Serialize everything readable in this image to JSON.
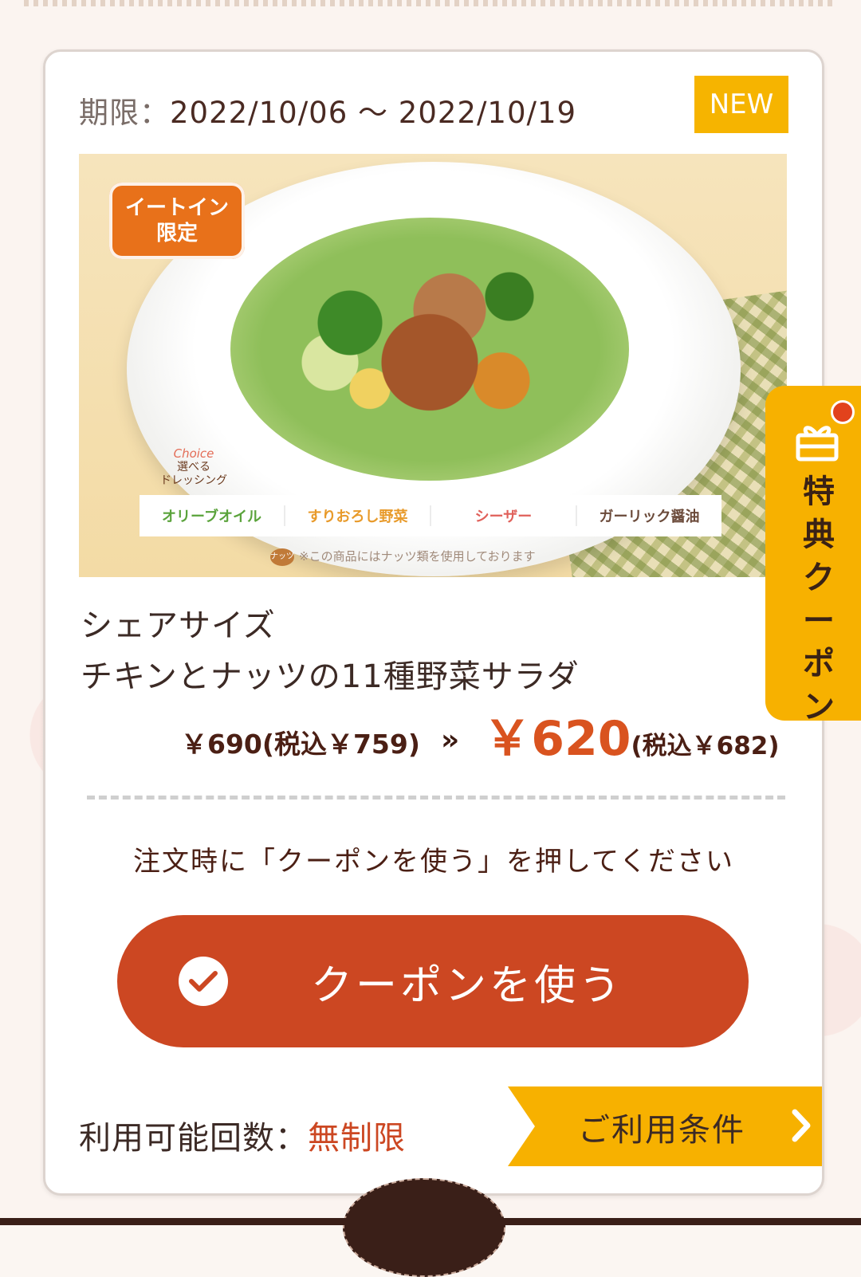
{
  "coupon": {
    "period_label": "期限：",
    "period_value": "2022/10/06 〜 2022/10/19",
    "badge": "NEW",
    "image": {
      "eatin_line1": "イートイン",
      "eatin_line2": "限定",
      "choice_en": "Choice",
      "choice_line1": "選べる",
      "choice_line2": "ドレッシング",
      "dressings": [
        {
          "label": "オリーブオイル",
          "color": "#5aa33b"
        },
        {
          "label": "すりおろし野菜",
          "color": "#e89a2a"
        },
        {
          "label": "シーザー",
          "color": "#e0605a"
        },
        {
          "label": "ガーリック醤油",
          "color": "#6b4a3a"
        }
      ],
      "nuts_icon": "ナッツ",
      "nuts_note": "※この商品にはナッツ類を使用しております"
    },
    "name_line1": "シェアサイズ",
    "name_line2": "チキンとナッツの11種野菜サラダ",
    "price_old": "￥690(税込￥759)",
    "price_new": "￥620",
    "price_new_tax": "(税込￥682)",
    "instruction": "注文時に「クーポンを使う」を押してください",
    "use_button": "クーポンを使う",
    "usage_label": "利用可能回数：",
    "usage_value": "無制限",
    "conditions_label": "ご利用条件"
  },
  "side_tab": {
    "label": "特典クーポン",
    "icon": "gift-icon"
  },
  "colors": {
    "accent": "#cc4722",
    "badge": "#f6b400",
    "side_tab": "#f7b100",
    "price_new": "#d9531f"
  }
}
